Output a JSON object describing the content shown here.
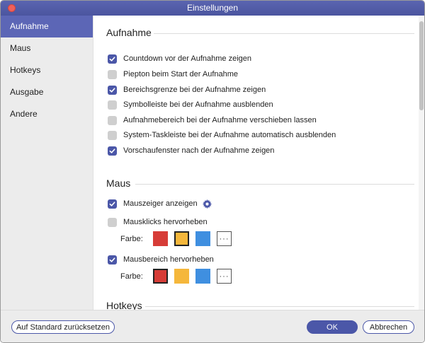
{
  "window": {
    "title": "Einstellungen"
  },
  "sidebar": {
    "items": [
      {
        "label": "Aufnahme",
        "active": true
      },
      {
        "label": "Maus",
        "active": false
      },
      {
        "label": "Hotkeys",
        "active": false
      },
      {
        "label": "Ausgabe",
        "active": false
      },
      {
        "label": "Andere",
        "active": false
      }
    ]
  },
  "aufnahme": {
    "title": "Aufnahme",
    "options": [
      {
        "label": "Countdown vor der Aufnahme zeigen",
        "checked": true
      },
      {
        "label": "Piepton beim Start der Aufnahme",
        "checked": false
      },
      {
        "label": "Bereichsgrenze bei der Aufnahme zeigen",
        "checked": true
      },
      {
        "label": "Symbolleiste bei der Aufnahme ausblenden",
        "checked": false
      },
      {
        "label": "Aufnahmebereich bei der Aufnahme verschieben lassen",
        "checked": false
      },
      {
        "label": "System-Taskleiste bei der Aufnahme automatisch ausblenden",
        "checked": false
      },
      {
        "label": "Vorschaufenster nach der Aufnahme zeigen",
        "checked": true
      }
    ]
  },
  "maus": {
    "title": "Maus",
    "show_cursor": {
      "label": "Mauszeiger anzeigen",
      "checked": true,
      "icon": "gear-icon"
    },
    "highlight_clicks": {
      "label": "Mausklicks hervorheben",
      "checked": false,
      "farbe_label": "Farbe:",
      "swatches": [
        {
          "color": "#d63c37",
          "selected": false
        },
        {
          "color": "#f5b73b",
          "selected": true
        },
        {
          "color": "#3f8fe0",
          "selected": false
        }
      ],
      "more_label": "···"
    },
    "highlight_area": {
      "label": "Mausbereich hervorheben",
      "checked": true,
      "farbe_label": "Farbe:",
      "swatches": [
        {
          "color": "#d63c37",
          "selected": true
        },
        {
          "color": "#f5b73b",
          "selected": false
        },
        {
          "color": "#3f8fe0",
          "selected": false
        }
      ],
      "more_label": "···"
    }
  },
  "hotkeys": {
    "title": "Hotkeys"
  },
  "footer": {
    "reset_label": "Auf Standard zurücksetzen",
    "ok_label": "OK",
    "cancel_label": "Abbrechen"
  }
}
